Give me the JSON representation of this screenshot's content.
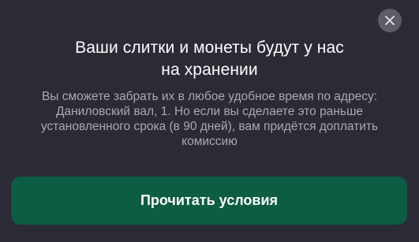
{
  "dialog": {
    "close_icon": "close-icon",
    "title_lines": [
      "Ваши слитки и монеты будут у нас",
      "на хранении"
    ],
    "description_lines": [
      "Вы сможете забрать их в любое удобное время по адресу:",
      "Даниловский вал, 1. Но если вы сделаете это раньше",
      "установленного срока (в 90 дней), вам придётся доплатить",
      "комиссию"
    ],
    "read_terms_label": "Прочитать условия"
  },
  "colors": {
    "background": "#2b2b36",
    "close_button_bg": "#5d5d67",
    "title": "#ffffff",
    "description": "#a9a9b2",
    "primary_button": "#0d5c44"
  }
}
